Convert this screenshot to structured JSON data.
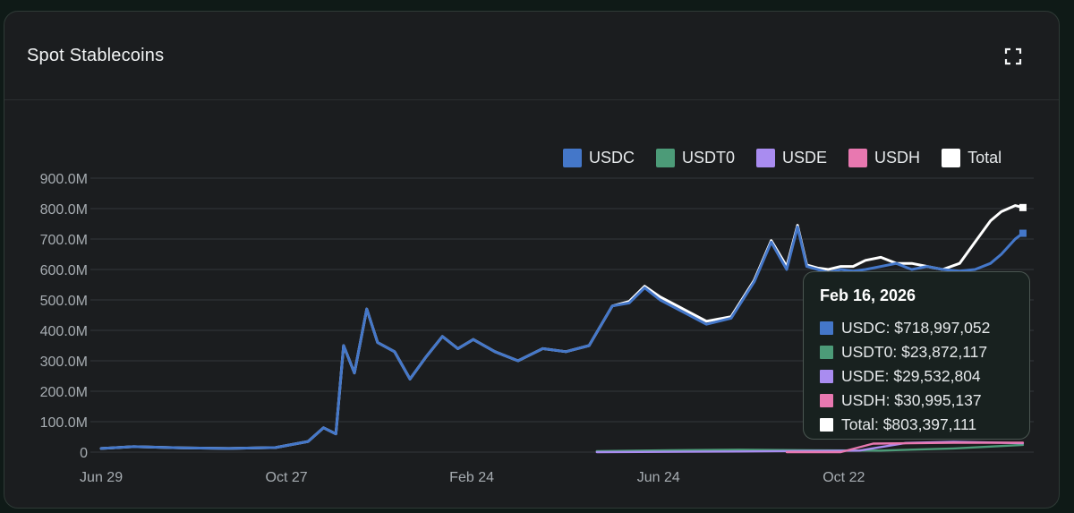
{
  "card": {
    "title": "Spot Stablecoins"
  },
  "icons": {
    "expand": "fullscreen-expand-icon"
  },
  "chart_data": {
    "type": "line",
    "ylabel": "",
    "xlabel": "",
    "ylim": [
      0,
      900000000
    ],
    "y_ticks": [
      "0",
      "100.0M",
      "200.0M",
      "300.0M",
      "400.0M",
      "500.0M",
      "600.0M",
      "700.0M",
      "800.0M",
      "900.0M"
    ],
    "x_ticks": [
      "Jun 29",
      "Oct 27",
      "Feb 24",
      "Jun 24",
      "Oct 22"
    ],
    "grid": true,
    "legend_position": "top-right",
    "series": [
      {
        "name": "USDC",
        "color": "#4477c9",
        "x": [
          "2023-06-29",
          "2023-07-20",
          "2023-08-20",
          "2023-09-20",
          "2023-10-20",
          "2023-11-10",
          "2023-11-20",
          "2023-11-28",
          "2023-12-03",
          "2023-12-10",
          "2023-12-18",
          "2023-12-25",
          "2024-01-05",
          "2024-01-15",
          "2024-01-25",
          "2024-02-05",
          "2024-02-15",
          "2024-02-25",
          "2024-03-10",
          "2024-03-25",
          "2024-04-10",
          "2024-04-25",
          "2024-05-10",
          "2024-05-25",
          "2024-06-05",
          "2024-06-15",
          "2024-06-25",
          "2024-07-10",
          "2024-07-25",
          "2024-08-10",
          "2024-08-25",
          "2024-09-05",
          "2024-09-15",
          "2024-09-22",
          "2024-09-28",
          "2024-10-05",
          "2024-10-12",
          "2024-10-20",
          "2024-10-28",
          "2024-11-05",
          "2024-11-15",
          "2024-11-25",
          "2024-12-05",
          "2024-12-15",
          "2024-12-25",
          "2025-01-05",
          "2025-01-15",
          "2025-01-25",
          "2025-02-01",
          "2025-02-10",
          "2025-02-15"
        ],
        "values": [
          12000000,
          18000000,
          14000000,
          12000000,
          15000000,
          35000000,
          80000000,
          60000000,
          350000000,
          260000000,
          470000000,
          360000000,
          330000000,
          240000000,
          310000000,
          380000000,
          340000000,
          370000000,
          330000000,
          300000000,
          340000000,
          330000000,
          350000000,
          480000000,
          490000000,
          540000000,
          500000000,
          460000000,
          420000000,
          440000000,
          560000000,
          690000000,
          600000000,
          740000000,
          610000000,
          600000000,
          590000000,
          600000000,
          595000000,
          600000000,
          610000000,
          620000000,
          600000000,
          610000000,
          600000000,
          595000000,
          600000000,
          620000000,
          650000000,
          700000000,
          718997052
        ]
      },
      {
        "name": "USDT0",
        "color": "#4c9b78",
        "x": [
          "2024-05-15",
          "2024-07-01",
          "2024-08-15",
          "2024-10-01",
          "2024-11-15",
          "2025-01-01",
          "2025-02-15"
        ],
        "values": [
          3000000,
          6000000,
          8000000,
          6000000,
          5000000,
          12000000,
          23872117
        ]
      },
      {
        "name": "USDE",
        "color": "#a98cf0",
        "x": [
          "2024-05-15",
          "2024-08-15",
          "2024-11-01",
          "2024-12-01",
          "2025-01-01",
          "2025-02-15"
        ],
        "values": [
          0,
          2000000,
          5000000,
          30000000,
          34000000,
          29532804
        ]
      },
      {
        "name": "USDH",
        "color": "#e878b0",
        "x": [
          "2024-09-15",
          "2024-10-20",
          "2024-11-10",
          "2025-01-01",
          "2025-02-15"
        ],
        "values": [
          0,
          0,
          28000000,
          31000000,
          30995137
        ]
      },
      {
        "name": "Total",
        "color": "#ffffff",
        "x": [
          "2023-06-29",
          "2023-07-20",
          "2023-08-20",
          "2023-09-20",
          "2023-10-20",
          "2023-11-10",
          "2023-11-20",
          "2023-11-28",
          "2023-12-03",
          "2023-12-10",
          "2023-12-18",
          "2023-12-25",
          "2024-01-05",
          "2024-01-15",
          "2024-01-25",
          "2024-02-05",
          "2024-02-15",
          "2024-02-25",
          "2024-03-10",
          "2024-03-25",
          "2024-04-10",
          "2024-04-25",
          "2024-05-10",
          "2024-05-25",
          "2024-06-05",
          "2024-06-15",
          "2024-06-25",
          "2024-07-10",
          "2024-07-25",
          "2024-08-10",
          "2024-08-25",
          "2024-09-05",
          "2024-09-15",
          "2024-09-22",
          "2024-09-28",
          "2024-10-05",
          "2024-10-12",
          "2024-10-20",
          "2024-10-28",
          "2024-11-05",
          "2024-11-15",
          "2024-11-25",
          "2024-12-05",
          "2024-12-15",
          "2024-12-25",
          "2025-01-05",
          "2025-01-15",
          "2025-01-25",
          "2025-02-01",
          "2025-02-10",
          "2025-02-15"
        ],
        "values": [
          12000000,
          18000000,
          14000000,
          12000000,
          15000000,
          35000000,
          80000000,
          60000000,
          350000000,
          260000000,
          470000000,
          360000000,
          330000000,
          240000000,
          310000000,
          380000000,
          340000000,
          370000000,
          330000000,
          300000000,
          340000000,
          330000000,
          350000000,
          480000000,
          495000000,
          545000000,
          510000000,
          470000000,
          430000000,
          445000000,
          565000000,
          695000000,
          610000000,
          745000000,
          615000000,
          605000000,
          600000000,
          610000000,
          610000000,
          630000000,
          640000000,
          620000000,
          620000000,
          610000000,
          600000000,
          620000000,
          690000000,
          760000000,
          790000000,
          810000000,
          803397111
        ]
      }
    ]
  },
  "tooltip": {
    "date": "Feb 16, 2026",
    "rows": [
      {
        "text": "USDC: $718,997,052",
        "color": "#4477c9"
      },
      {
        "text": "USDT0: $23,872,117",
        "color": "#4c9b78"
      },
      {
        "text": "USDE: $29,532,804",
        "color": "#a98cf0"
      },
      {
        "text": "USDH: $30,995,137",
        "color": "#e878b0"
      },
      {
        "text": "Total: $803,397,111",
        "color": "#ffffff"
      }
    ]
  }
}
